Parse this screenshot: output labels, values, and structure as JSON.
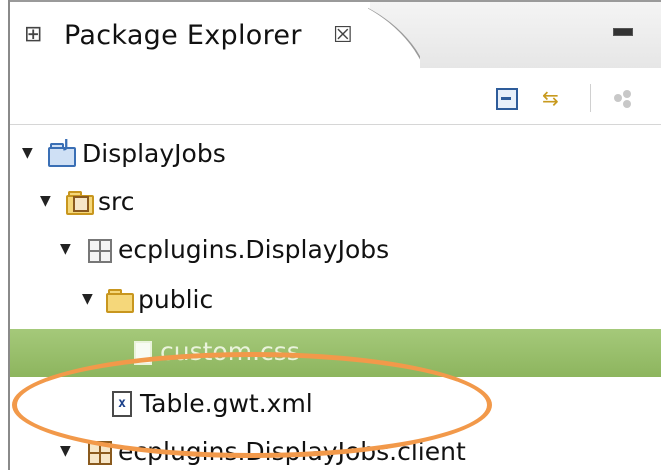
{
  "view": {
    "tab_title": "Package Explorer",
    "tab_close_glyph": "☒"
  },
  "tree": {
    "rows": [
      {
        "label": "DisplayJobs",
        "icon": "java-project-icon",
        "expanded": true
      },
      {
        "label": "src",
        "icon": "source-folder-icon",
        "expanded": true
      },
      {
        "label": "ecplugins.DisplayJobs",
        "icon": "package-icon",
        "expanded": true
      },
      {
        "label": "public",
        "icon": "folder-icon",
        "expanded": true
      },
      {
        "label": "custom.css",
        "icon": "file-icon",
        "selected": true
      },
      {
        "label": "Table.gwt.xml",
        "icon": "xml-file-icon"
      },
      {
        "label": "ecplugins.DisplayJobs.client",
        "icon": "package-icon",
        "expanded": true
      }
    ]
  },
  "annotation": {
    "color": "#f2994a"
  },
  "colors": {
    "selection": "#8db55e"
  }
}
